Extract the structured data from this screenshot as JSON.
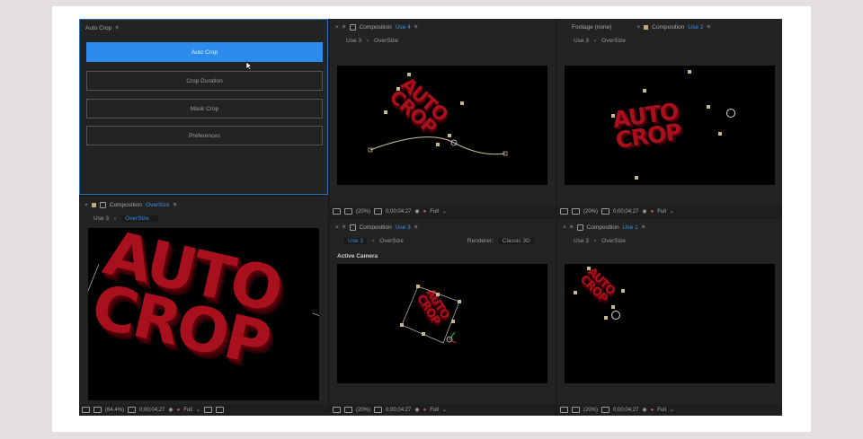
{
  "autocrop": {
    "title": "Auto Crop",
    "buttons": [
      "Auto Crop",
      "Crop Duration",
      "Mask Crop",
      "Preferences"
    ]
  },
  "panels": {
    "bottom_left": {
      "comp_word": "Composition",
      "comp_name": "OverSize",
      "crumb_a": "Use 3",
      "crumb_b": "OverSize",
      "zoom": "(64.4%)",
      "time": "0;00;04;27",
      "res": "Full"
    },
    "top_mid": {
      "comp_word": "Composition",
      "comp_name": "Use 4",
      "crumb_a": "Use 3",
      "crumb_b": "OverSize",
      "zoom": "(20%)",
      "time": "0;00;04;27",
      "res": "Full"
    },
    "top_right": {
      "footage": "Footage (none)",
      "comp_word": "Composition",
      "comp_name": "Use 2",
      "crumb_a": "Use 3",
      "crumb_b": "OverSize",
      "zoom": "(20%)",
      "time": "0;00;04;27",
      "res": "Full"
    },
    "bottom_mid": {
      "comp_word": "Composition",
      "comp_name": "Use 3",
      "crumb_a": "Use 3",
      "crumb_b": "OverSize",
      "renderer_label": "Renderer:",
      "renderer": "Classic 3D",
      "camera": "Active Camera",
      "zoom": "(20%)",
      "time": "0;00;04;27",
      "res": "Full"
    },
    "bottom_right": {
      "comp_word": "Composition",
      "comp_name": "Use 1",
      "crumb_a": "Use 3",
      "crumb_b": "OverSize",
      "zoom": "(20%)",
      "time": "0;00;04;27",
      "res": "Full"
    }
  },
  "artwork": {
    "line1": "AUTO",
    "line2": "CROP"
  },
  "colors": {
    "accent": "#2d8ceb",
    "text_red": "#a8101e"
  }
}
